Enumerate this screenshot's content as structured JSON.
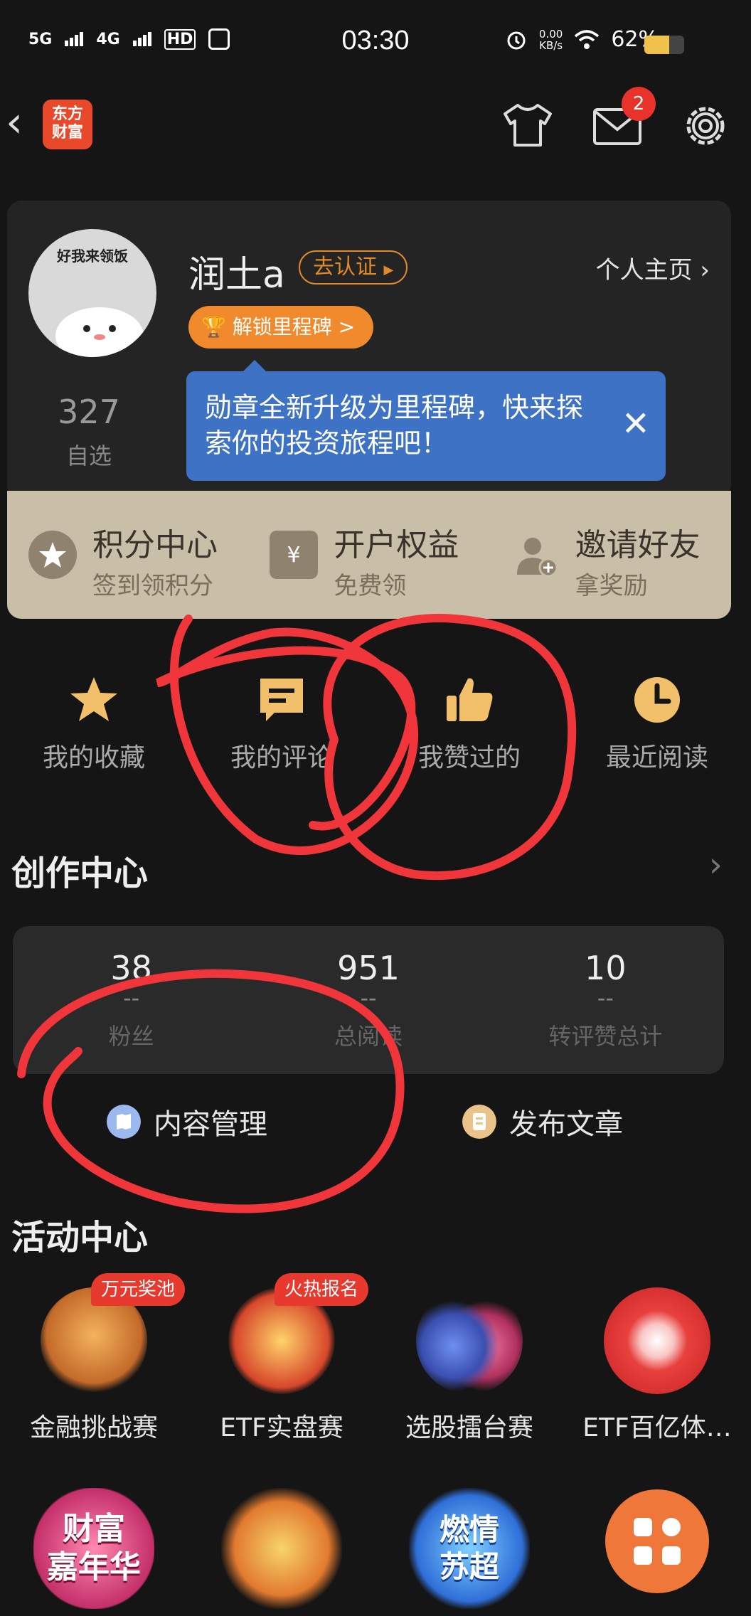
{
  "status_bar": {
    "net1": "5G",
    "net2": "4G",
    "hd": "HD",
    "time": "03:30",
    "speed_value": "0.00",
    "speed_unit": "KB/s",
    "battery": "62%",
    "battery_level": 0.62
  },
  "nav": {
    "logo_line1": "东方",
    "logo_line2": "财富",
    "mail_badge": "2"
  },
  "profile": {
    "avatar_caption": "好我来领饭",
    "username": "润土a",
    "verify_label": "去认证",
    "homepage_label": "个人主页",
    "milestone_label": "解锁里程碑 >",
    "watchlist_count": "327",
    "watchlist_label": "自选"
  },
  "tooltip": {
    "text": "勋章全新升级为里程碑，快来探索你的投资旅程吧！"
  },
  "rewards": [
    {
      "title": "积分中心",
      "subtitle": "签到领积分"
    },
    {
      "title": "开户权益",
      "subtitle": "免费领"
    },
    {
      "title": "邀请好友",
      "subtitle": "拿奖励"
    }
  ],
  "quick_actions": [
    {
      "label": "我的收藏",
      "icon": "star-icon"
    },
    {
      "label": "我的评论",
      "icon": "comment-icon"
    },
    {
      "label": "我赞过的",
      "icon": "thumbs-up-icon"
    },
    {
      "label": "最近阅读",
      "icon": "clock-icon"
    }
  ],
  "creator": {
    "title": "创作中心",
    "stats": [
      {
        "value": "38",
        "delta": "--",
        "label": "粉丝"
      },
      {
        "value": "951",
        "delta": "--",
        "label": "总阅读"
      },
      {
        "value": "10",
        "delta": "--",
        "label": "转评赞总计"
      }
    ],
    "content_manage_label": "内容管理",
    "publish_label": "发布文章"
  },
  "events": {
    "title": "活动中心",
    "items": [
      {
        "label": "金融挑战赛",
        "tag": "万元奖池"
      },
      {
        "label": "ETF实盘赛",
        "tag": "火热报名"
      },
      {
        "label": "选股擂台赛",
        "tag": ""
      },
      {
        "label": "ETF百亿体…",
        "tag": ""
      }
    ]
  },
  "promos": [
    {
      "text_line1": "财富",
      "text_line2": "嘉年华"
    },
    {
      "text_line1": "",
      "text_line2": ""
    },
    {
      "text_line1": "燃情",
      "text_line2": "苏超"
    }
  ],
  "colors": {
    "background": "#151515",
    "card": "#242424",
    "accent_orange": "#f08a2c",
    "tooltip_blue": "#3d72c4",
    "annotation_red": "#f0363a",
    "badge_red": "#e8332a"
  }
}
